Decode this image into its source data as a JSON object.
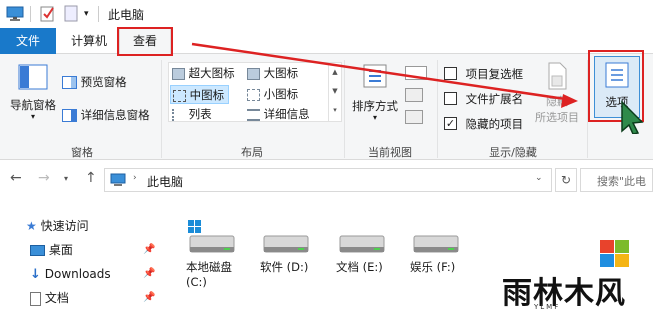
{
  "window": {
    "title": "此电脑"
  },
  "ribbon_tabs": {
    "file": "文件",
    "computer": "计算机",
    "view": "查看"
  },
  "pane_group": {
    "nav_pane": "导航窗格",
    "preview_pane": "预览窗格",
    "details_pane": "详细信息窗格",
    "label": "窗格"
  },
  "layout_group": {
    "xl_icons": "超大图标",
    "large_icons": "大图标",
    "medium_icons": "中图标",
    "small_icons": "小图标",
    "list": "列表",
    "details": "详细信息",
    "label": "布局"
  },
  "current_view_group": {
    "sort": "排序方式",
    "label": "当前视图"
  },
  "show_hide_group": {
    "item_checkboxes": "项目复选框",
    "file_extensions": "文件扩展名",
    "hidden_items": "隐藏的项目",
    "hide_selected": "隐藏",
    "hide_selected_2": "所选项目",
    "label": "显示/隐藏",
    "item_checkboxes_checked": false,
    "file_extensions_checked": false,
    "hidden_items_checked": true
  },
  "options": {
    "label": "选项"
  },
  "address": {
    "path": "此电脑",
    "search_placeholder": "搜索\"此电"
  },
  "nav_tree": {
    "quick_access": "快速访问",
    "desktop": "桌面",
    "downloads": "Downloads",
    "documents": "文档"
  },
  "drives": [
    {
      "label": "本地磁盘",
      "label2": "(C:)"
    },
    {
      "label": "软件 (D:)"
    },
    {
      "label": "文档 (E:)"
    },
    {
      "label": "娱乐 (F:)"
    }
  ],
  "watermark": {
    "text": "雨林木风",
    "sub": "YLMF"
  },
  "colors": {
    "accent": "#1979ca",
    "highlight": "#dd2222",
    "selected": "#cce8ff"
  }
}
